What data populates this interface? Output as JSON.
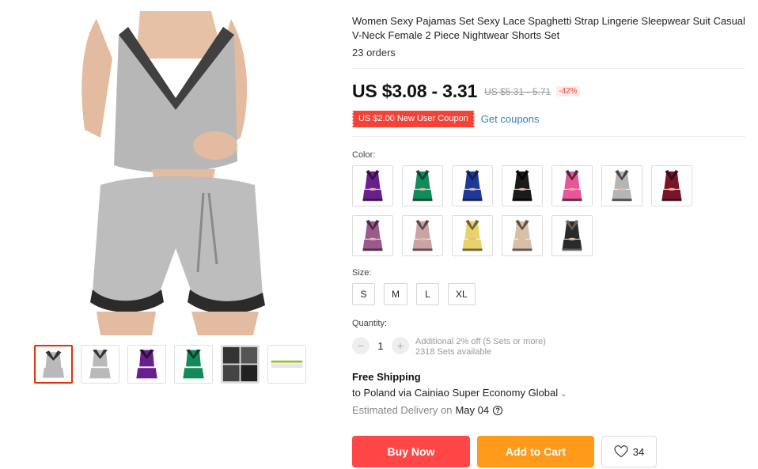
{
  "product": {
    "title": "Women Sexy Pajamas Set Sexy Lace Spaghetti Strap Lingerie Sleepwear Suit Casual V-Neck Female 2 Piece Nightwear Shorts Set",
    "orders": "23 orders"
  },
  "price": {
    "current": "US $3.08 - 3.31",
    "original": "US $5.31 - 5.71",
    "discount": "-42%"
  },
  "coupon": {
    "badge": "US $2.00 New User Coupon",
    "link": "Get coupons"
  },
  "gallery": {
    "main_image_icon": "pajama-set-photo",
    "thumbnails": [
      {
        "icon": "gray-set-model",
        "color": "#b9b9b9",
        "active": true
      },
      {
        "icon": "gray-set-flat",
        "color": "#b9b9b9",
        "active": false
      },
      {
        "icon": "purple-set",
        "color": "#6a1f8f",
        "active": false
      },
      {
        "icon": "green-set",
        "color": "#138a5a",
        "active": false
      },
      {
        "icon": "lace-detail",
        "color": "#222222",
        "active": false
      },
      {
        "icon": "size-chart",
        "color": "#9bbf3f",
        "active": false
      }
    ]
  },
  "color": {
    "label": "Color:",
    "swatches": [
      {
        "color": "#6a1f8f",
        "lace": "#2a1030"
      },
      {
        "color": "#138a5a",
        "lace": "#0c3b2a"
      },
      {
        "color": "#1f3a96",
        "lace": "#0f1a44"
      },
      {
        "color": "#1b1b1b",
        "lace": "#000000"
      },
      {
        "color": "#e9559b",
        "lace": "#3a1a2a"
      },
      {
        "color": "#b5b5b5",
        "lace": "#333333"
      },
      {
        "color": "#7a1428",
        "lace": "#2a0a10"
      },
      {
        "color": "#9b5a8e",
        "lace": "#3a2030"
      },
      {
        "color": "#c9a3a6",
        "lace": "#4a3a3a"
      },
      {
        "color": "#e8d36a",
        "lace": "#5a4a2a"
      },
      {
        "color": "#d8c0a8",
        "lace": "#4a3a3a"
      },
      {
        "color": "#2a2a2a",
        "lace": "#6a6a6a"
      }
    ]
  },
  "size": {
    "label": "Size:",
    "options": [
      "S",
      "M",
      "L",
      "XL"
    ]
  },
  "quantity": {
    "label": "Quantity:",
    "minus": "−",
    "plus": "+",
    "value": "1",
    "discount_note": "Additional 2% off (5 Sets or more)",
    "available": "2318 Sets available"
  },
  "shipping": {
    "title": "Free Shipping",
    "destination": "to Poland via Cainiao Super Economy Global",
    "chevron": "⌄",
    "estimated_label": "Estimated Delivery on",
    "estimated_date": "May 04",
    "help_icon": "?"
  },
  "actions": {
    "buy_now": "Buy Now",
    "add_to_cart": "Add to Cart",
    "wishlist_count": "34"
  },
  "colors": {
    "accent_red": "#ff4747",
    "cart_orange": "#ff9a1a",
    "link_blue": "#2e7fd3"
  }
}
